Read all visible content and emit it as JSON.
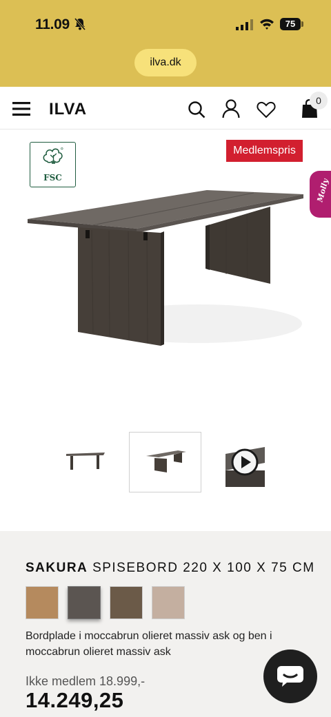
{
  "status_bar": {
    "time": "11.09",
    "battery": "75"
  },
  "browser": {
    "url": "ilva.dk"
  },
  "header": {
    "logo": "ILVA",
    "cart_count": "0"
  },
  "hero": {
    "certification": "FSC",
    "member_badge": "Medlemspris",
    "chat_tab": "Molly"
  },
  "product": {
    "title_bold": "SAKURA",
    "title_rest": "SPISEBORD 220 X 100 X 75 CM",
    "description": "Bordplade i moccabrun olieret massiv ask og ben i moccabrun olieret massiv ask",
    "old_price": "Ikke medlem 18.999,-",
    "price": "14.249,25",
    "swatches": [
      {
        "color": "#b58a5e",
        "selected": false
      },
      {
        "color": "#5b5551",
        "selected": true
      },
      {
        "color": "#6b5a48",
        "selected": false
      },
      {
        "color": "#c4afa0",
        "selected": false
      }
    ]
  },
  "colors": {
    "chrome": "#dcbf54",
    "accent_red": "#d21f2f",
    "molly": "#b01e6f"
  }
}
